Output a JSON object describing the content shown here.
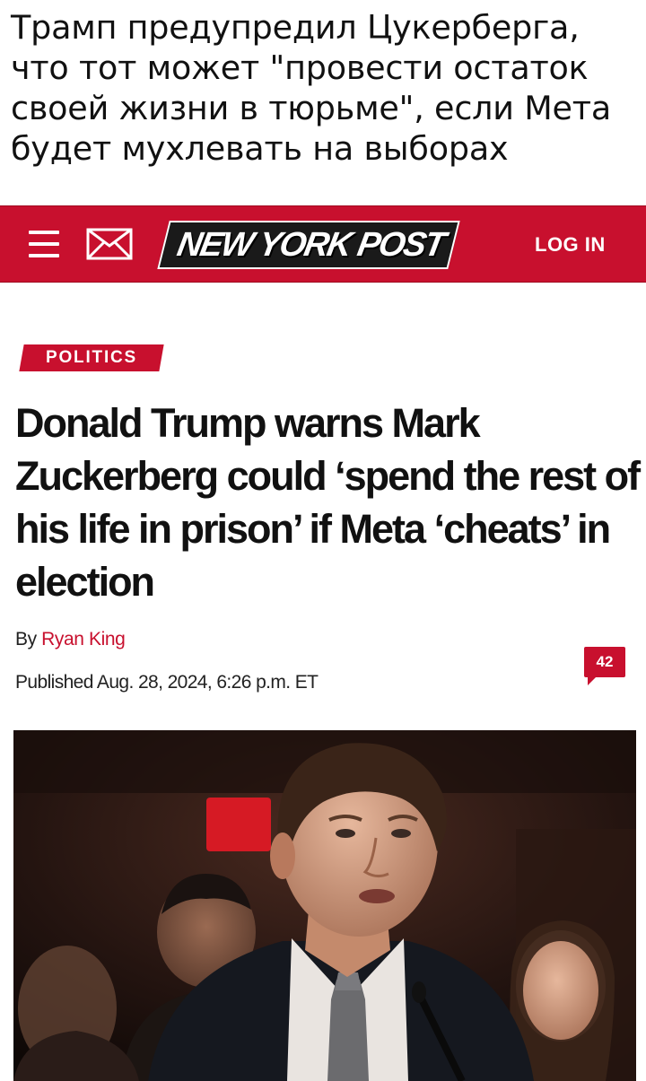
{
  "caption": "Трамп предупредил Цукерберга, что тот может \"провести остаток своей жизни в тюрьме\", если Мета будет мухлевать на выборах",
  "header": {
    "logo_text": "NEW YORK POST",
    "login_label": "LOG IN",
    "menu_icon": "hamburger-menu-icon",
    "mail_icon": "mail-icon",
    "brand_color": "#c8102e"
  },
  "article": {
    "section": "POLITICS",
    "headline": "Donald Trump warns Mark Zuckerberg could ‘spend the rest of his life in prison’ if Meta ‘cheats’ in election",
    "byline_prefix": "By",
    "author": "Ryan King",
    "published": "Published Aug. 28, 2024, 6:26 p.m. ET",
    "comment_count": "42"
  }
}
